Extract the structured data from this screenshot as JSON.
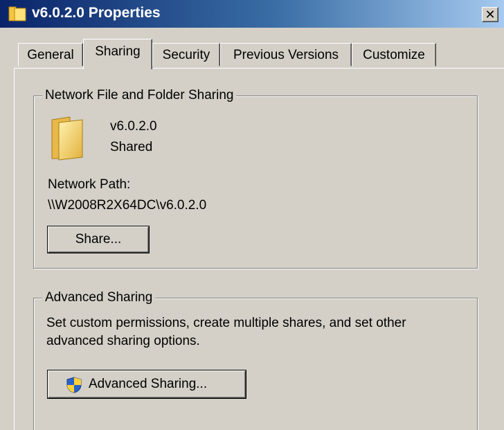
{
  "window": {
    "title": "v6.0.2.0 Properties",
    "close_glyph": "✕",
    "icon": "folder-icon"
  },
  "tabs": [
    {
      "label": "General",
      "active": false
    },
    {
      "label": "Sharing",
      "active": true
    },
    {
      "label": "Security",
      "active": false
    },
    {
      "label": "Previous Versions",
      "active": false
    },
    {
      "label": "Customize",
      "active": false
    }
  ],
  "network_sharing": {
    "legend": "Network File and Folder Sharing",
    "folder_icon": "folder-icon",
    "folder_name": "v6.0.2.0",
    "status": "Shared",
    "path_label": "Network Path:",
    "path_value": "\\\\W2008R2X64DC\\v6.0.2.0",
    "share_button": "Share..."
  },
  "advanced_sharing": {
    "legend": "Advanced Sharing",
    "description_line1": "Set custom permissions, create multiple shares, and set other",
    "description_line2": "advanced sharing options.",
    "button_icon": "uac-shield-icon",
    "button_label": "Advanced Sharing..."
  },
  "colors": {
    "dialog_bg": "#d4d0c8",
    "titlebar_start": "#0a246a",
    "titlebar_end": "#a6caf0",
    "title_text": "#ffffff"
  }
}
